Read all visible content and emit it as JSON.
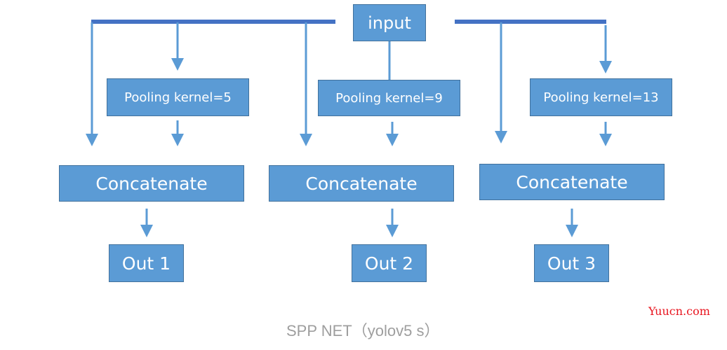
{
  "colors": {
    "box_fill": "#5b9bd5",
    "box_border": "#41719c",
    "line": "#4472c4",
    "arrow": "#5b9bd5",
    "caption": "#9e9e9e",
    "watermark": "#e8141e"
  },
  "input": {
    "label": "input"
  },
  "branches": [
    {
      "pool_label": "Pooling kernel=5",
      "concat_label": "Concatenate",
      "out_label": "Out 1"
    },
    {
      "pool_label": "Pooling kernel=9",
      "concat_label": "Concatenate",
      "out_label": "Out 2"
    },
    {
      "pool_label": "Pooling kernel=13",
      "concat_label": "Concatenate",
      "out_label": "Out 3"
    }
  ],
  "caption": "SPP NET（yolov5 s）",
  "watermark": "Yuucn.com"
}
